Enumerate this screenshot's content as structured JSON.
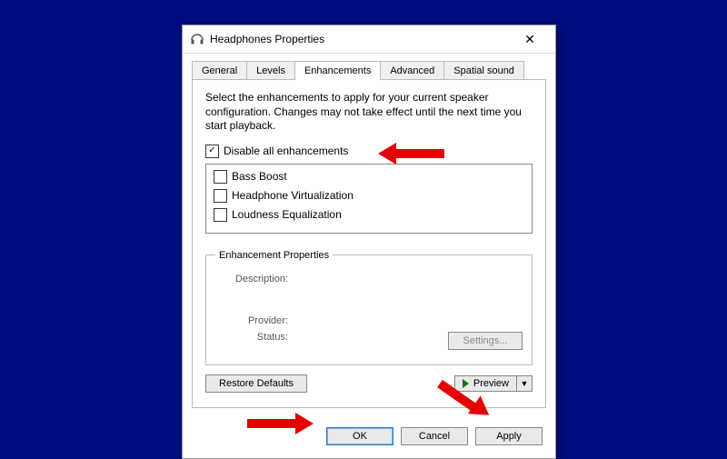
{
  "window": {
    "title": "Headphones Properties"
  },
  "tabs": {
    "items": [
      "General",
      "Levels",
      "Enhancements",
      "Advanced",
      "Spatial sound"
    ],
    "active_index": 2
  },
  "panel": {
    "instructions": "Select the enhancements to apply for your current speaker configuration. Changes may not take effect until the next time you start playback.",
    "disable_all": {
      "label": "Disable all enhancements",
      "checked": true
    },
    "enhancements": [
      {
        "label": "Bass Boost",
        "checked": false
      },
      {
        "label": "Headphone Virtualization",
        "checked": false
      },
      {
        "label": "Loudness Equalization",
        "checked": false
      }
    ],
    "props": {
      "legend": "Enhancement Properties",
      "description_label": "Description:",
      "provider_label": "Provider:",
      "status_label": "Status:",
      "settings_btn": "Settings..."
    },
    "restore_btn": "Restore Defaults",
    "preview_btn": "Preview"
  },
  "buttons": {
    "ok": "OK",
    "cancel": "Cancel",
    "apply": "Apply"
  }
}
